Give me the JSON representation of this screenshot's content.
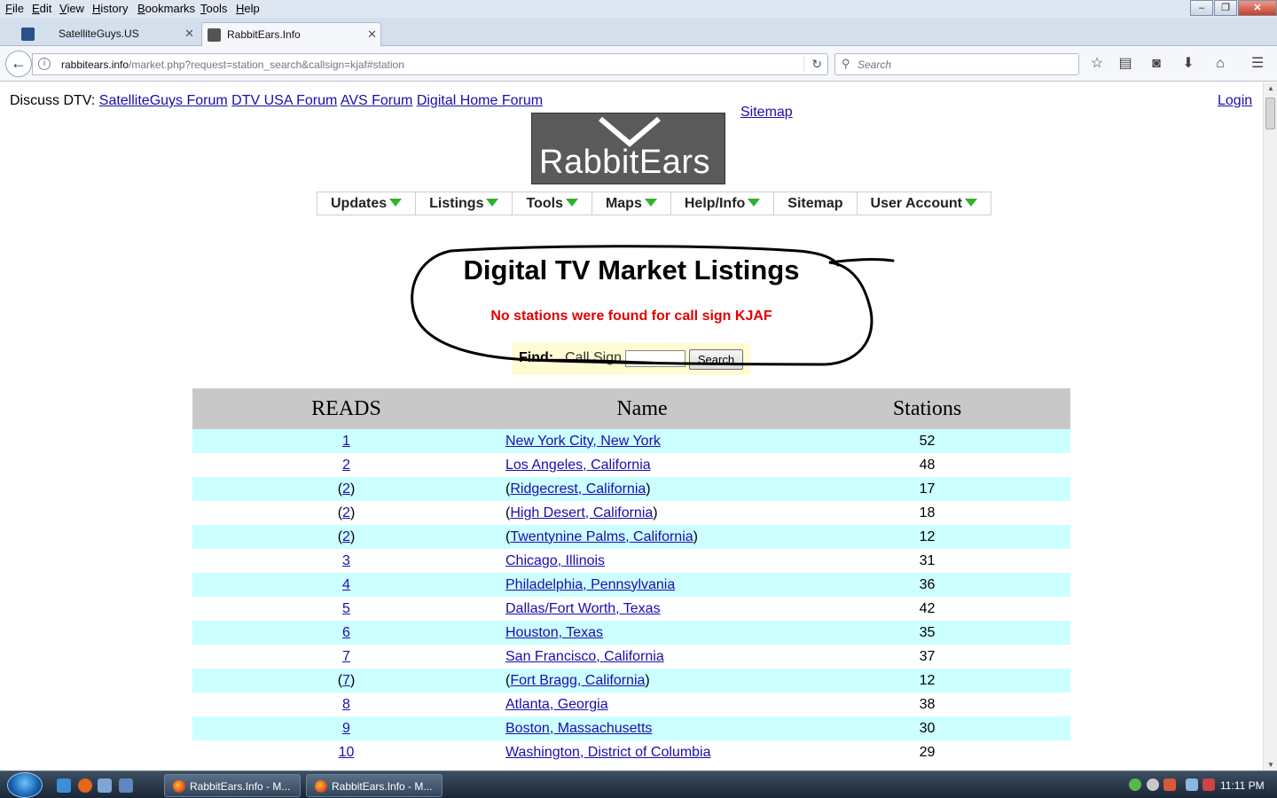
{
  "browser": {
    "menu": [
      "File",
      "Edit",
      "View",
      "History",
      "Bookmarks",
      "Tools",
      "Help"
    ],
    "tabs": [
      {
        "title": "SatelliteGuys.US"
      },
      {
        "title": "RabbitEars.Info"
      }
    ],
    "url_host": "rabbitears.info",
    "url_path": "/market.php?request=station_search&callsign=kjaf#station",
    "search_placeholder": "Search"
  },
  "page": {
    "discuss_label": "Discuss DTV:",
    "discuss_links": [
      "SatelliteGuys Forum",
      "DTV USA Forum",
      "AVS Forum",
      "Digital Home Forum"
    ],
    "sitemap_link": "Sitemap",
    "login_link": "Login",
    "logo_text": "RabbitEars",
    "nav": [
      {
        "label": "Updates",
        "dropdown": true
      },
      {
        "label": "Listings",
        "dropdown": true
      },
      {
        "label": "Tools",
        "dropdown": true
      },
      {
        "label": "Maps",
        "dropdown": true
      },
      {
        "label": "Help/Info",
        "dropdown": true
      },
      {
        "label": "Sitemap",
        "dropdown": false
      },
      {
        "label": "User Account",
        "dropdown": true
      }
    ],
    "title": "Digital TV Market Listings",
    "message": "No stations were found for call sign KJAF",
    "find": {
      "label": "Find:",
      "field_label": "Call Sign",
      "value": "",
      "button": "Search"
    },
    "table": {
      "headers": [
        "READS",
        "Name",
        "Stations"
      ],
      "rows": [
        {
          "reads": "1",
          "name": "New York City, New York",
          "stations": "52",
          "sub": false
        },
        {
          "reads": "2",
          "name": "Los Angeles, California",
          "stations": "48",
          "sub": false
        },
        {
          "reads": "2",
          "name": "Ridgecrest, California",
          "stations": "17",
          "sub": true
        },
        {
          "reads": "2",
          "name": "High Desert, California",
          "stations": "18",
          "sub": true
        },
        {
          "reads": "2",
          "name": "Twentynine Palms, California",
          "stations": "12",
          "sub": true
        },
        {
          "reads": "3",
          "name": "Chicago, Illinois",
          "stations": "31",
          "sub": false
        },
        {
          "reads": "4",
          "name": "Philadelphia, Pennsylvania",
          "stations": "36",
          "sub": false
        },
        {
          "reads": "5",
          "name": "Dallas/Fort Worth, Texas",
          "stations": "42",
          "sub": false
        },
        {
          "reads": "6",
          "name": "Houston, Texas",
          "stations": "35",
          "sub": false
        },
        {
          "reads": "7",
          "name": "San Francisco, California",
          "stations": "37",
          "sub": false
        },
        {
          "reads": "7",
          "name": "Fort Bragg, California",
          "stations": "12",
          "sub": true
        },
        {
          "reads": "8",
          "name": "Atlanta, Georgia",
          "stations": "38",
          "sub": false
        },
        {
          "reads": "9",
          "name": "Boston, Massachusetts",
          "stations": "30",
          "sub": false
        },
        {
          "reads": "10",
          "name": "Washington, District of Columbia",
          "stations": "29",
          "sub": false
        }
      ]
    }
  },
  "taskbar": {
    "buttons": [
      "RabbitEars.Info - M...",
      "RabbitEars.Info - M..."
    ],
    "clock": "11:11 PM"
  },
  "colors": {
    "link": "#1a0dab",
    "error": "#e00000",
    "row_alt": "#ccffff",
    "header_bg": "#c8c8c8",
    "find_bg": "#fffcd4",
    "nav_triangle": "#2db32d"
  }
}
